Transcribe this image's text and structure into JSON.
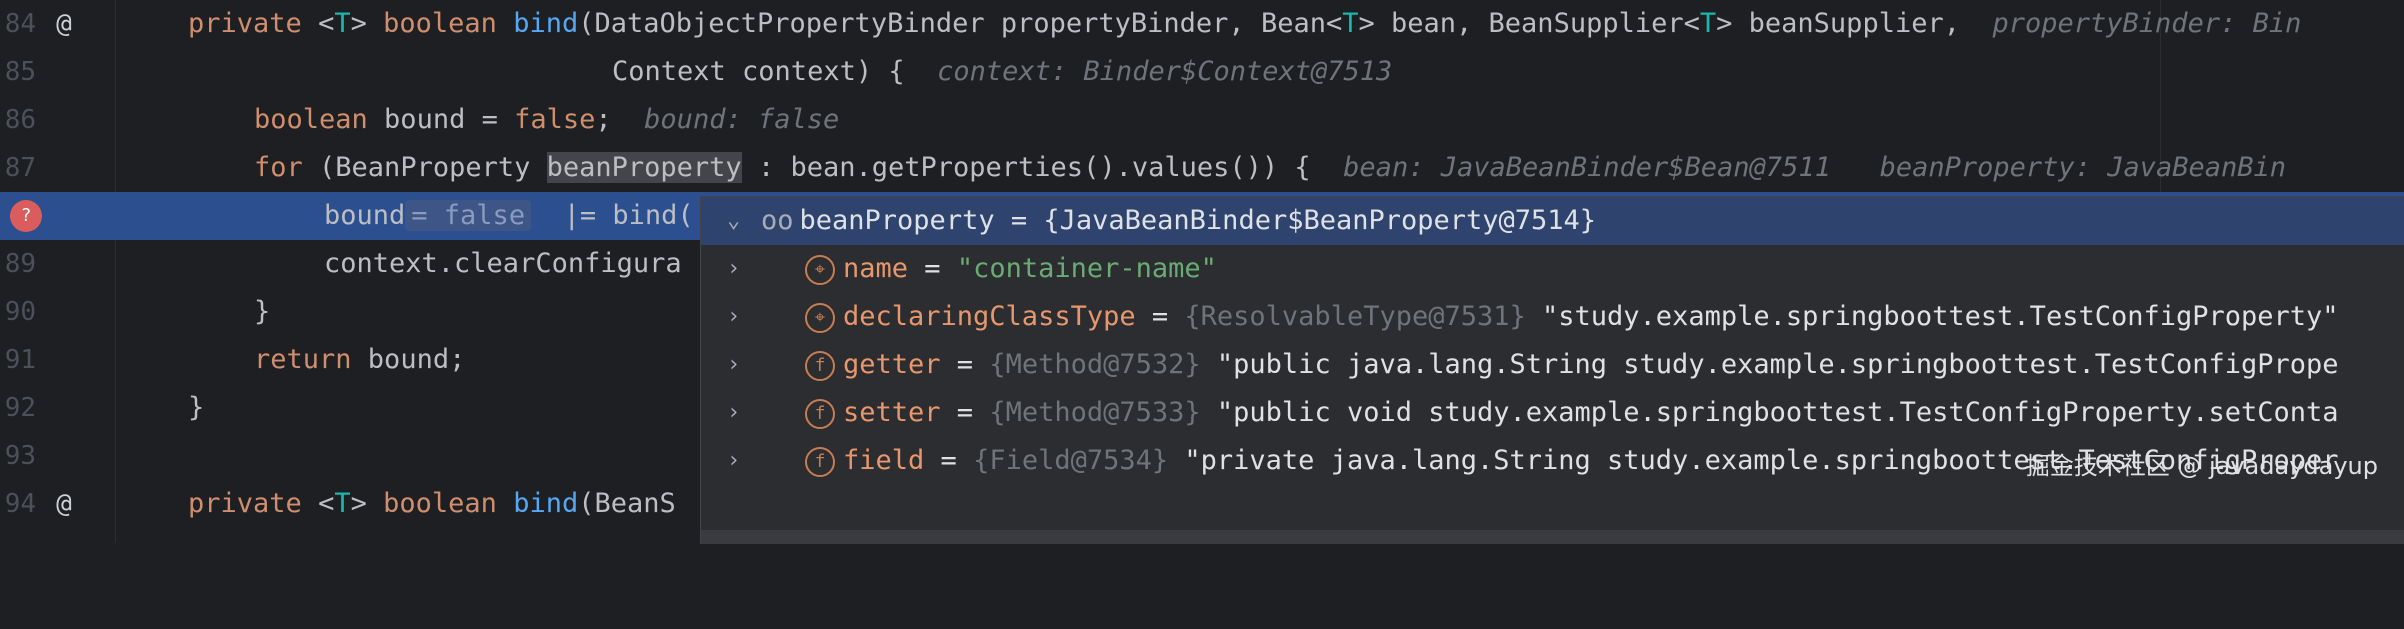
{
  "gutter": {
    "line_numbers": [
      "84",
      "85",
      "86",
      "87",
      "88",
      "89",
      "90",
      "91",
      "92",
      "93",
      "94"
    ]
  },
  "code": {
    "l84": {
      "kw_private": "private",
      "type_param_open": "<",
      "type_param": "T",
      "type_param_close": ">",
      "kw_boolean": "boolean",
      "method": "bind",
      "params": "(DataObjectPropertyBinder propertyBinder, Bean<",
      "t1": "T",
      "p2": "> bean, BeanSupplier<",
      "t2": "T",
      "p3": "> beanSupplier,",
      "hint": "propertyBinder: Bin"
    },
    "l85": {
      "text": "Context context) {",
      "hint": "context: Binder$Context@7513"
    },
    "l86": {
      "kw_boolean": "boolean",
      "text1": " bound = ",
      "kw_false": "false",
      "text2": ";",
      "hint": "bound: false"
    },
    "l87": {
      "kw_for": "for",
      "text1": " (BeanProperty ",
      "var": "beanProperty",
      "text2": " : bean.getProperties().values()) {",
      "hint1": "bean: JavaBeanBinder$Bean@7511",
      "hint2": "beanProperty: JavaBeanBin"
    },
    "l88": {
      "text1": "bound",
      "inline_value": "= false",
      "text2": " |= ",
      "method": "bind("
    },
    "l89": {
      "text": "context.clearConfigura"
    },
    "l90": {
      "text": "}"
    },
    "l91": {
      "kw_return": "return",
      "text": " bound;"
    },
    "l92": {
      "text": "}"
    },
    "l94": {
      "kw_private": "private",
      "lt": "<",
      "type_param": "T",
      "gt": ">",
      "kw_boolean": "boolean",
      "method": "bind",
      "text": "(BeanS"
    }
  },
  "gutter_icons": {
    "l84": "@",
    "l94": "@",
    "breakpoint": "?"
  },
  "debug_popup": {
    "root": {
      "name": "beanProperty",
      "eq": " = ",
      "value": "{JavaBeanBinder$BeanProperty@7514}"
    },
    "children": [
      {
        "icon": "field-icon-final",
        "name": "name",
        "eq": " = ",
        "ref": "",
        "value": "\"container-name\""
      },
      {
        "icon": "field-icon-final",
        "name": "declaringClassType",
        "eq": " = ",
        "ref": "{ResolvableType@7531}",
        "value": " \"study.example.springboottest.TestConfigProperty\""
      },
      {
        "icon": "field-icon",
        "name": "getter",
        "eq": " = ",
        "ref": "{Method@7532}",
        "value": " \"public java.lang.String study.example.springboottest.TestConfigPrope"
      },
      {
        "icon": "field-icon",
        "name": "setter",
        "eq": " = ",
        "ref": "{Method@7533}",
        "value": " \"public void study.example.springboottest.TestConfigProperty.setConta"
      },
      {
        "icon": "field-icon",
        "name": "field",
        "eq": " = ",
        "ref": "{Field@7534}",
        "value": " \"private java.lang.String study.example.springboottest.TestConfigProper"
      }
    ],
    "field_glyph": "f",
    "final_glyph": "⌖"
  },
  "watermark": "掘金技术社区 @ javadaydayup",
  "colors": {
    "background": "#1e1f22",
    "exec_line": "#2c4f8f",
    "keyword": "#cf8e6d",
    "method": "#56a8f5",
    "string": "#6aab73"
  }
}
